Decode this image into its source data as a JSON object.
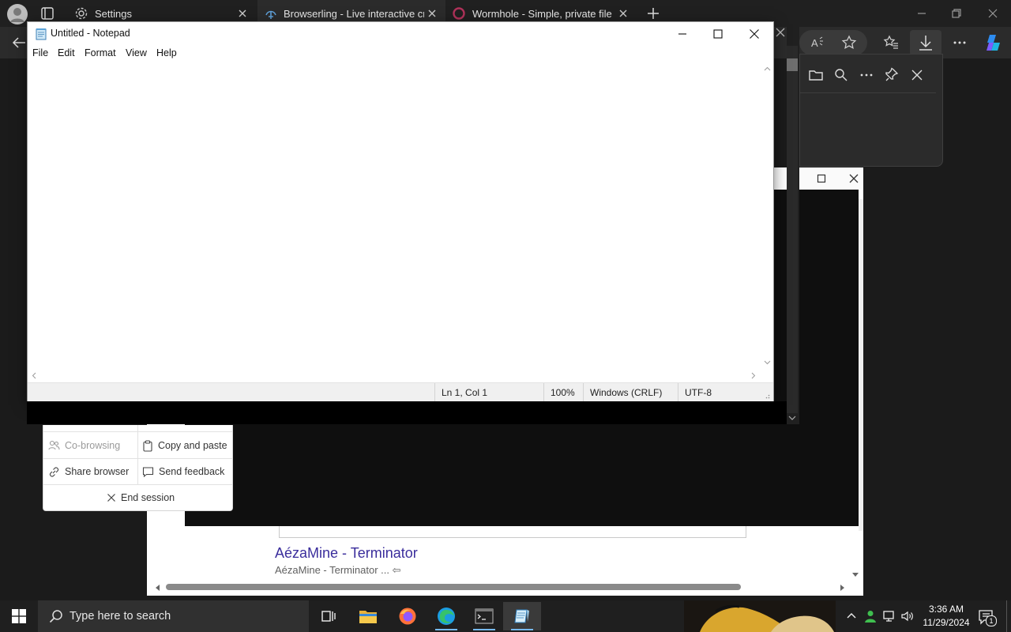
{
  "browser": {
    "tabs": [
      {
        "label": "Settings",
        "icon": "gear-icon"
      },
      {
        "label": "Browserling - Live interactive cros",
        "icon": "browserling-icon"
      },
      {
        "label": "Wormhole - Simple, private file sh",
        "icon": "wormhole-icon"
      }
    ],
    "downloads_flyout": {
      "icons": [
        "folder-icon",
        "search-icon",
        "more-icon",
        "pin-icon",
        "close-icon"
      ]
    }
  },
  "background_page": {
    "result_title": "AézaMine - Terminator",
    "result_subtitle": "AézaMine - Terminator ... ⇦"
  },
  "browserling_panel": {
    "items": [
      {
        "label": "Co-browsing",
        "icon": "users-icon",
        "disabled": true
      },
      {
        "label": "Copy and paste",
        "icon": "clipboard-icon",
        "disabled": false
      },
      {
        "label": "Share browser",
        "icon": "link-icon",
        "disabled": false
      },
      {
        "label": "Send feedback",
        "icon": "feedback-icon",
        "disabled": false
      }
    ],
    "end_session": "End session"
  },
  "notepad": {
    "title": "Untitled - Notepad",
    "menu": [
      "File",
      "Edit",
      "Format",
      "View",
      "Help"
    ],
    "content": "",
    "status": {
      "position": "Ln 1, Col 1",
      "zoom": "100%",
      "line_ending": "Windows (CRLF)",
      "encoding": "UTF-8"
    }
  },
  "taskbar": {
    "search_placeholder": "Type here to search",
    "apps": [
      "task-view-icon",
      "file-explorer-icon",
      "firefox-icon",
      "edge-icon",
      "terminal-icon",
      "notepad-icon"
    ],
    "time": "3:36 AM",
    "date": "11/29/2024",
    "notification_count": "1"
  },
  "colors": {
    "accent": "#76b9ed",
    "link": "#3a2d9c",
    "taskbar": "#1f1f1f"
  }
}
